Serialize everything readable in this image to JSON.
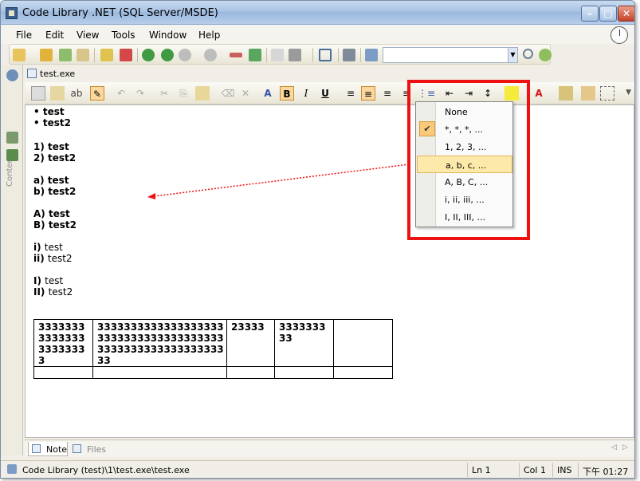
{
  "window": {
    "title": "Code Library .NET (SQL Server/MSDE)"
  },
  "menu": {
    "items": [
      "File",
      "Edit",
      "View",
      "Tools",
      "Window",
      "Help"
    ]
  },
  "sidebar": {
    "label": "Contents"
  },
  "document": {
    "tab_label": "test.exe"
  },
  "search": {
    "value": ""
  },
  "editor": {
    "lines": [
      {
        "prefix": "• ",
        "text": "test",
        "bold_all": true
      },
      {
        "prefix": "• ",
        "text": "test2",
        "bold_all": true
      },
      {
        "prefix": "1) ",
        "text": "test",
        "bold_all": true
      },
      {
        "prefix": "2) ",
        "text": "test2",
        "bold_all": true
      },
      {
        "prefix": "a) ",
        "text": "test",
        "bold_all": true
      },
      {
        "prefix": "b) ",
        "text": "test2",
        "bold_all": true
      },
      {
        "prefix": "A) ",
        "text": "test",
        "bold_all": true
      },
      {
        "prefix": "B) ",
        "text": "test2",
        "bold_all": true
      },
      {
        "prefix": "i) ",
        "text": "test",
        "bold_all": false
      },
      {
        "prefix": "ii) ",
        "text": "test2",
        "bold_all": false
      },
      {
        "prefix": "I) ",
        "text": "test",
        "bold_all": false
      },
      {
        "prefix": "II) ",
        "text": "test2",
        "bold_all": false
      }
    ],
    "table": {
      "row1": [
        "3333333\n3333333\n3333333\n3",
        "3333333333333333333\n3333333333333333333\n3333333333333333333\n33",
        "23333",
        "3333333\n33",
        ""
      ],
      "row2": [
        "",
        "",
        "",
        "",
        ""
      ]
    }
  },
  "format_toolbar": {
    "bold": "B",
    "italic": "I",
    "underline": "U"
  },
  "numbering_menu": {
    "items": [
      {
        "label": "None",
        "checked": false,
        "hover": false
      },
      {
        "label": "*, *, *, ...",
        "checked": true,
        "hover": false
      },
      {
        "label": "1, 2, 3, ...",
        "checked": false,
        "hover": false
      },
      {
        "label": "a, b, c, ...",
        "checked": false,
        "hover": true
      },
      {
        "label": "A, B, C, ...",
        "checked": false,
        "hover": false
      },
      {
        "label": "i, ii, iii, ...",
        "checked": false,
        "hover": false
      },
      {
        "label": "I, II, III, ...",
        "checked": false,
        "hover": false
      }
    ],
    "check_glyph": "✔"
  },
  "bottom_tabs": {
    "note": "Note",
    "files": "Files"
  },
  "status": {
    "path": "Code Library (test)\\1\\test.exe\\test.exe",
    "line": "Ln 1",
    "col": "Col 1",
    "mode": "INS",
    "time": "下午 01:27"
  },
  "colors": {
    "highlight": "#ee1111",
    "menu_hover": "#fde9a9",
    "active_button": "#fcd79e"
  }
}
